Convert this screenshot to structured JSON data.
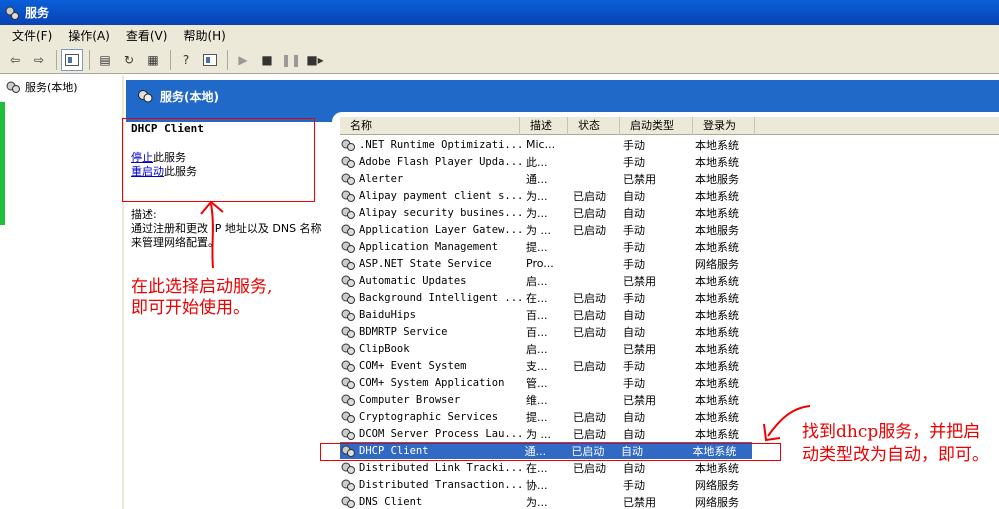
{
  "window": {
    "title": "服务"
  },
  "menu": [
    "文件(F)",
    "操作(A)",
    "查看(V)",
    "帮助(H)"
  ],
  "tree": {
    "root": "服务(本地)"
  },
  "header": {
    "title": "服务(本地)"
  },
  "panel": {
    "service_name": "DHCP Client",
    "stop_link": "停止",
    "stop_suffix": "此服务",
    "restart_link": "重启动",
    "restart_suffix": "此服务",
    "desc_label": "描述:",
    "desc_text": "通过注册和更改 IP 地址以及 DNS 名称来管理网络配置。"
  },
  "annotations": {
    "left": [
      "在此选择启动服务,",
      "即可开始使用。"
    ],
    "right": "找到dhcp服务，并把启动类型改为自动，即可。"
  },
  "columns": [
    "名称",
    "描述",
    "状态",
    "启动类型",
    "登录为"
  ],
  "rows": [
    [
      ".NET Runtime Optimizati...",
      "Mic...",
      "",
      "手动",
      "本地系统"
    ],
    [
      "Adobe Flash Player Upda...",
      "此...",
      "",
      "手动",
      "本地系统"
    ],
    [
      "Alerter",
      "通...",
      "",
      "已禁用",
      "本地服务"
    ],
    [
      "Alipay payment client s...",
      "为...",
      "已启动",
      "自动",
      "本地系统"
    ],
    [
      "Alipay security busines...",
      "为...",
      "已启动",
      "自动",
      "本地系统"
    ],
    [
      "Application Layer Gatew...",
      "为 ...",
      "已启动",
      "手动",
      "本地服务"
    ],
    [
      "Application Management",
      "提...",
      "",
      "手动",
      "本地系统"
    ],
    [
      "ASP.NET State Service",
      "Pro...",
      "",
      "手动",
      "网络服务"
    ],
    [
      "Automatic Updates",
      "启...",
      "",
      "已禁用",
      "本地系统"
    ],
    [
      "Background Intelligent ...",
      "在...",
      "已启动",
      "手动",
      "本地系统"
    ],
    [
      "BaiduHips",
      "百...",
      "已启动",
      "自动",
      "本地系统"
    ],
    [
      "BDMRTP Service",
      "百...",
      "已启动",
      "自动",
      "本地系统"
    ],
    [
      "ClipBook",
      "启...",
      "",
      "已禁用",
      "本地系统"
    ],
    [
      "COM+ Event System",
      "支...",
      "已启动",
      "手动",
      "本地系统"
    ],
    [
      "COM+ System Application",
      "管...",
      "",
      "手动",
      "本地系统"
    ],
    [
      "Computer Browser",
      "维...",
      "",
      "已禁用",
      "本地系统"
    ],
    [
      "Cryptographic Services",
      "提...",
      "已启动",
      "自动",
      "本地系统"
    ],
    [
      "DCOM Server Process Lau...",
      "为 ...",
      "已启动",
      "自动",
      "本地系统"
    ],
    [
      "DHCP Client",
      "通...",
      "已启动",
      "自动",
      "本地系统"
    ],
    [
      "Distributed Link Tracki...",
      "在...",
      "已启动",
      "自动",
      "本地系统"
    ],
    [
      "Distributed Transaction...",
      "协...",
      "",
      "手动",
      "网络服务"
    ],
    [
      "DNS Client",
      "为...",
      "",
      "已禁用",
      "网络服务"
    ]
  ],
  "selected_row": 18
}
